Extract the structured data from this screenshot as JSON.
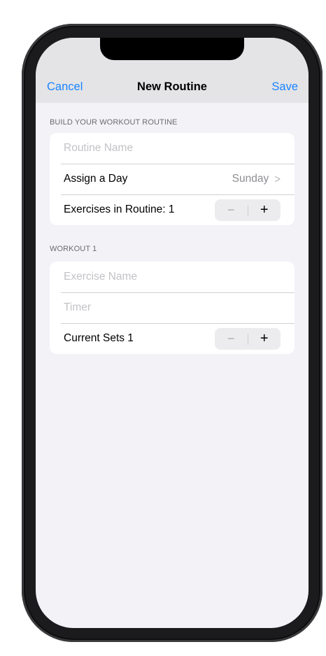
{
  "navbar": {
    "cancel_label": "Cancel",
    "title": "New Routine",
    "save_label": "Save"
  },
  "section_build": {
    "header": "BUILD YOUR  WORKOUT ROUTINE",
    "routine_name_placeholder": "Routine Name",
    "routine_name_value": "",
    "assign_day_label": "Assign a Day",
    "assign_day_value": "Sunday",
    "exercises_label": "Exercises in Routine: 1"
  },
  "section_workout": {
    "header": "WORKOUT 1",
    "exercise_name_placeholder": "Exercise Name",
    "exercise_name_value": "",
    "timer_placeholder": "Timer",
    "timer_value": "",
    "current_sets_label": "Current Sets 1"
  },
  "stepper": {
    "minus_glyph": "−",
    "plus_glyph": "+"
  },
  "colors": {
    "accent": "#1a84ff",
    "background": "#f2f2f7",
    "navbar": "#e4e4e6"
  }
}
